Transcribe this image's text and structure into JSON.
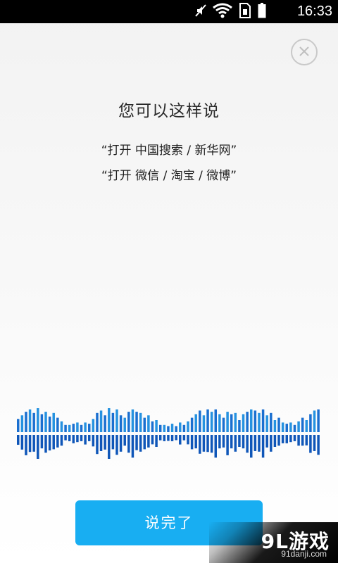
{
  "status_bar": {
    "time": "16:33",
    "icons": [
      "mute-icon",
      "wifi-icon",
      "sim-icon",
      "battery-icon"
    ]
  },
  "dialog": {
    "close_icon": "close-icon",
    "title": "您可以这样说",
    "hints": [
      "“打开 中国搜索 / 新华网”",
      "“打开 微信 / 淘宝 / 微博”"
    ],
    "done_button": "说完了"
  },
  "voice_wave": {
    "levels": [
      0.55,
      0.7,
      0.85,
      0.95,
      0.8,
      1.0,
      0.75,
      0.85,
      0.65,
      0.8,
      0.6,
      0.45,
      0.3,
      0.3,
      0.35,
      0.4,
      0.3,
      0.4,
      0.35,
      0.55,
      0.8,
      0.9,
      0.7,
      1.0,
      0.8,
      0.95,
      0.7,
      0.6,
      0.85,
      0.95,
      0.85,
      0.8,
      0.6,
      0.7,
      0.45,
      0.5,
      0.3,
      0.3,
      0.25,
      0.35,
      0.25,
      0.4,
      0.3,
      0.45,
      0.6,
      0.75,
      0.9,
      0.7,
      0.95,
      0.85,
      0.95,
      0.75,
      0.6,
      0.85,
      0.75,
      0.8,
      0.5,
      0.75,
      0.85,
      0.95,
      0.9,
      0.8,
      0.95,
      0.7,
      0.8,
      0.5,
      0.6,
      0.4,
      0.35,
      0.4,
      0.3,
      0.45,
      0.6,
      0.5,
      0.75,
      0.9,
      0.95
    ],
    "colors": [
      "#1a6fd0",
      "#2592e0",
      "#0f56b8"
    ]
  },
  "watermark": {
    "main": "9L游戏",
    "sub": "91danji.com"
  }
}
